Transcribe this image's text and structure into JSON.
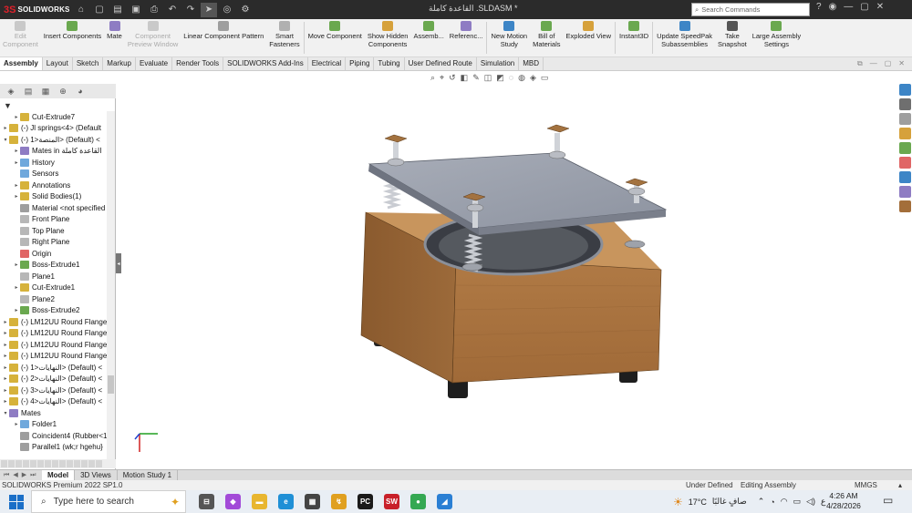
{
  "app": {
    "logo_ds": "3S",
    "logo_name": "SOLIDWORKS",
    "document_title": "القاعدة كاملة .SLDASM *",
    "search_placeholder": "Search Commands"
  },
  "command_bar": {
    "items": [
      {
        "label": "Edit\nComponent",
        "disabled": true,
        "icon_color": "#c9c9c9"
      },
      {
        "label": "Insert Components",
        "disabled": false,
        "icon_color": "#6aa84f"
      },
      {
        "label": "Mate",
        "disabled": false,
        "icon_color": "#8e7cc3"
      },
      {
        "label": "Component\nPreview Window",
        "disabled": true,
        "icon_color": "#c9c9c9"
      },
      {
        "label": "Linear Component Pattern",
        "disabled": false,
        "icon_color": "#9e9e9e"
      },
      {
        "label": "Smart\nFasteners",
        "disabled": false,
        "icon_color": "#b0b0b0"
      },
      {
        "label": "Move Component",
        "disabled": false,
        "icon_color": "#6aa84f"
      },
      {
        "label": "Show Hidden\nComponents",
        "disabled": false,
        "icon_color": "#d6a13b"
      },
      {
        "label": "Assemb...",
        "disabled": false,
        "icon_color": "#6aa84f"
      },
      {
        "label": "Referenc...",
        "disabled": false,
        "icon_color": "#8e7cc3"
      },
      {
        "label": "New Motion\nStudy",
        "disabled": false,
        "icon_color": "#3d85c6"
      },
      {
        "label": "Bill of\nMaterials",
        "disabled": false,
        "icon_color": "#6aa84f"
      },
      {
        "label": "Exploded View",
        "disabled": false,
        "icon_color": "#d6a13b"
      },
      {
        "label": "Instant3D",
        "disabled": false,
        "icon_color": "#6aa84f"
      },
      {
        "label": "Update SpeedPak\nSubassemblies",
        "disabled": false,
        "icon_color": "#3d85c6"
      },
      {
        "label": "Take\nSnapshot",
        "disabled": false,
        "icon_color": "#555555"
      },
      {
        "label": "Large Assembly\nSettings",
        "disabled": false,
        "icon_color": "#6aa84f"
      }
    ]
  },
  "tabs": [
    "Assembly",
    "Layout",
    "Sketch",
    "Markup",
    "Evaluate",
    "Render Tools",
    "SOLIDWORKS Add-Ins",
    "Electrical",
    "Piping",
    "Tubing",
    "User Defined Route",
    "Simulation",
    "MBD"
  ],
  "active_tab": "Assembly",
  "tree": [
    {
      "label": "Cut-Extrude7",
      "indent": 1,
      "toggle": "▸",
      "icon_color": "#d6b23b"
    },
    {
      "label": "(-) Jl springs<4> (Default",
      "indent": 0,
      "toggle": "▸",
      "icon_color": "#d6b23b"
    },
    {
      "label": "(-) المنصة<1> (Default) <",
      "indent": 0,
      "toggle": "▾",
      "icon_color": "#d6b23b"
    },
    {
      "label": "Mates in القاعدة كاملة",
      "indent": 1,
      "toggle": "▸",
      "icon_color": "#8e7cc3"
    },
    {
      "label": "History",
      "indent": 1,
      "toggle": "▸",
      "icon_color": "#6fa8dc"
    },
    {
      "label": "Sensors",
      "indent": 1,
      "toggle": "",
      "icon_color": "#6fa8dc"
    },
    {
      "label": "Annotations",
      "indent": 1,
      "toggle": "▸",
      "icon_color": "#d6b23b"
    },
    {
      "label": "Solid Bodies(1)",
      "indent": 1,
      "toggle": "▸",
      "icon_color": "#d6b23b"
    },
    {
      "label": "Material <not specified",
      "indent": 1,
      "toggle": "",
      "icon_color": "#9e9e9e"
    },
    {
      "label": "Front Plane",
      "indent": 1,
      "toggle": "",
      "icon_color": "#b7b7b7"
    },
    {
      "label": "Top Plane",
      "indent": 1,
      "toggle": "",
      "icon_color": "#b7b7b7"
    },
    {
      "label": "Right Plane",
      "indent": 1,
      "toggle": "",
      "icon_color": "#b7b7b7"
    },
    {
      "label": "Origin",
      "indent": 1,
      "toggle": "",
      "icon_color": "#e06666"
    },
    {
      "label": "Boss-Extrude1",
      "indent": 1,
      "toggle": "▸",
      "icon_color": "#6aa84f"
    },
    {
      "label": "Plane1",
      "indent": 1,
      "toggle": "",
      "icon_color": "#b7b7b7"
    },
    {
      "label": "Cut-Extrude1",
      "indent": 1,
      "toggle": "▸",
      "icon_color": "#d6b23b"
    },
    {
      "label": "Plane2",
      "indent": 1,
      "toggle": "",
      "icon_color": "#b7b7b7"
    },
    {
      "label": "Boss-Extrude2",
      "indent": 1,
      "toggle": "▸",
      "icon_color": "#6aa84f"
    },
    {
      "label": "(-) LM12UU Round Flange",
      "indent": 0,
      "toggle": "▸",
      "icon_color": "#d6b23b"
    },
    {
      "label": "(-) LM12UU Round Flange",
      "indent": 0,
      "toggle": "▸",
      "icon_color": "#d6b23b"
    },
    {
      "label": "(-) LM12UU Round Flange",
      "indent": 0,
      "toggle": "▸",
      "icon_color": "#d6b23b"
    },
    {
      "label": "(-) LM12UU Round Flange",
      "indent": 0,
      "toggle": "▸",
      "icon_color": "#d6b23b"
    },
    {
      "label": "(-) النهايات<1> (Default) <",
      "indent": 0,
      "toggle": "▸",
      "icon_color": "#d6b23b"
    },
    {
      "label": "(-) النهايات<2> (Default) <",
      "indent": 0,
      "toggle": "▸",
      "icon_color": "#d6b23b"
    },
    {
      "label": "(-) النهايات<3> (Default) <",
      "indent": 0,
      "toggle": "▸",
      "icon_color": "#d6b23b"
    },
    {
      "label": "(-) النهايات<4> (Default) <",
      "indent": 0,
      "toggle": "▸",
      "icon_color": "#d6b23b"
    },
    {
      "label": "Mates",
      "indent": 0,
      "toggle": "▾",
      "icon_color": "#8e7cc3"
    },
    {
      "label": "Folder1",
      "indent": 1,
      "toggle": "▸",
      "icon_color": "#6fa8dc"
    },
    {
      "label": "Coincident4 (Rubber<1",
      "indent": 1,
      "toggle": "",
      "icon_color": "#9e9e9e"
    },
    {
      "label": "Parallel1 (wk;r hgehu}",
      "indent": 1,
      "toggle": "",
      "icon_color": "#9e9e9e"
    }
  ],
  "bottom_tabs": [
    "Model",
    "3D Views",
    "Motion Study 1"
  ],
  "active_bottom_tab": "Model",
  "status": {
    "product": "SOLIDWORKS Premium 2022 SP1.0",
    "state": "Under Defined",
    "mode": "Editing Assembly",
    "units": "MMGS"
  },
  "taskbar": {
    "search_placeholder": "Type here to search",
    "weather": "17°C",
    "weather_desc": "صافٍ غالبًا",
    "lang": "ع",
    "time": "4:26 AM",
    "date": "4/28/2026",
    "apps": [
      {
        "name": "task-view",
        "label": "⊟",
        "color": "#555555"
      },
      {
        "name": "copilot",
        "label": "◆",
        "color": "#a24ad8"
      },
      {
        "name": "file-explorer",
        "label": "▬",
        "color": "#e8b630"
      },
      {
        "name": "edge",
        "label": "e",
        "color": "#1e8fd6"
      },
      {
        "name": "store",
        "label": "▦",
        "color": "#444444"
      },
      {
        "name": "sticky",
        "label": "↯",
        "color": "#e0a020"
      },
      {
        "name": "pycharm",
        "label": "PC",
        "color": "#1a1a1a"
      },
      {
        "name": "solidworks",
        "label": "SW",
        "color": "#c8202a"
      },
      {
        "name": "chrome",
        "label": "●",
        "color": "#34a853"
      },
      {
        "name": "app",
        "label": "◢",
        "color": "#2a7fd4"
      }
    ]
  }
}
